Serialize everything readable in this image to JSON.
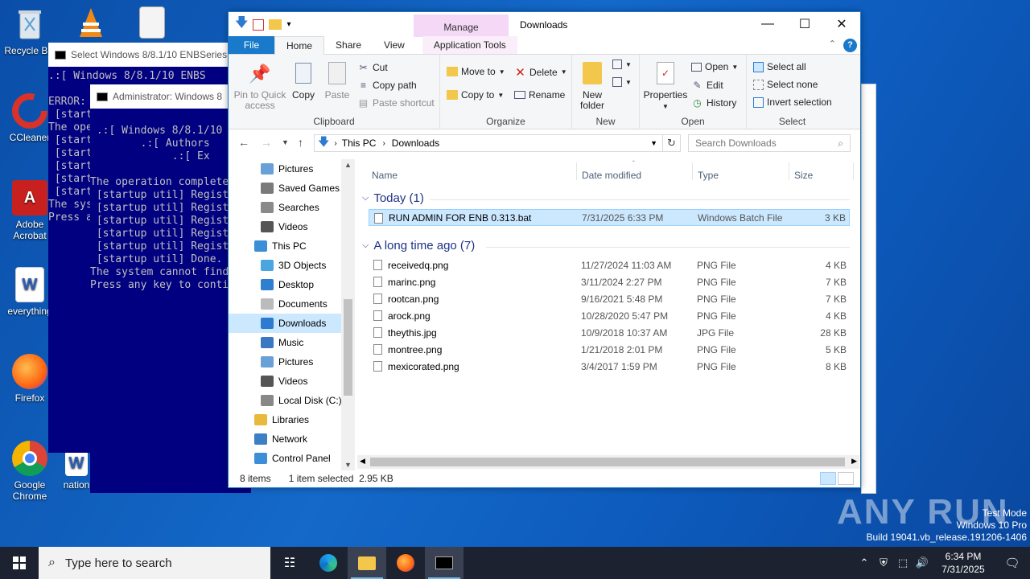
{
  "desktop": {
    "icons": [
      {
        "label": "Recycle Bin"
      },
      {
        "label": "CCleaner"
      },
      {
        "label": "Adobe Acrobat"
      },
      {
        "label": "everything"
      },
      {
        "label": "Firefox"
      },
      {
        "label": "Google Chrome"
      },
      {
        "label": "nation"
      }
    ]
  },
  "console_back": {
    "title": "Select Windows 8/8.1/10 ENBSeries 0",
    "lines": [
      ".:[ Windows 8/8.1/10 ENBS",
      "",
      "ERROR:",
      " [start",
      "The ope",
      " [start",
      " [start",
      " [start",
      " [start",
      " [start",
      "The sys",
      "Press a"
    ]
  },
  "console_front": {
    "title": "Administrator:  Windows 8",
    "lines": [
      "",
      " .:[ Windows 8/8.1/10",
      "        .:[ Authors",
      "             .:[ Ex",
      "",
      "The operation complete",
      " [startup util] Regist",
      " [startup util] Regist",
      " [startup util] Regist",
      " [startup util] Regist",
      " [startup util] Regist",
      " [startup util] Done.",
      "The system cannot find",
      "Press any key to conti"
    ]
  },
  "explorer": {
    "title": "Downloads",
    "manage_tab": "Manage",
    "tabs": {
      "file": "File",
      "home": "Home",
      "share": "Share",
      "view": "View",
      "app_tools": "Application Tools"
    },
    "ribbon": {
      "clipboard": {
        "label": "Clipboard",
        "pin": "Pin to Quick access",
        "copy": "Copy",
        "paste": "Paste",
        "cut": "Cut",
        "copy_path": "Copy path",
        "paste_shortcut": "Paste shortcut"
      },
      "organize": {
        "label": "Organize",
        "move_to": "Move to",
        "copy_to": "Copy to",
        "delete": "Delete",
        "rename": "Rename"
      },
      "new": {
        "label": "New",
        "new_folder": "New folder"
      },
      "open": {
        "label": "Open",
        "properties": "Properties",
        "open": "Open",
        "edit": "Edit",
        "history": "History"
      },
      "select": {
        "label": "Select",
        "select_all": "Select all",
        "select_none": "Select none",
        "invert": "Invert selection"
      }
    },
    "address": {
      "parts": [
        "This PC",
        "Downloads"
      ],
      "search_placeholder": "Search Downloads"
    },
    "nav": [
      {
        "label": "Pictures",
        "indent": 1,
        "color": "#6aa0d8"
      },
      {
        "label": "Saved Games",
        "indent": 1,
        "color": "#7a7a7a"
      },
      {
        "label": "Searches",
        "indent": 1,
        "color": "#8a8a8a"
      },
      {
        "label": "Videos",
        "indent": 1,
        "color": "#555"
      },
      {
        "label": "This PC",
        "indent": 0,
        "color": "#3c8fd6"
      },
      {
        "label": "3D Objects",
        "indent": 1,
        "color": "#4aa6e0"
      },
      {
        "label": "Desktop",
        "indent": 1,
        "color": "#2f7fd0"
      },
      {
        "label": "Documents",
        "indent": 1,
        "color": "#bbb"
      },
      {
        "label": "Downloads",
        "indent": 1,
        "color": "#2d7bd0",
        "selected": true
      },
      {
        "label": "Music",
        "indent": 1,
        "color": "#3a78c4"
      },
      {
        "label": "Pictures",
        "indent": 1,
        "color": "#6aa0d8"
      },
      {
        "label": "Videos",
        "indent": 1,
        "color": "#555"
      },
      {
        "label": "Local Disk (C:)",
        "indent": 1,
        "color": "#888"
      },
      {
        "label": "Libraries",
        "indent": 0,
        "color": "#e8b93c"
      },
      {
        "label": "Network",
        "indent": 0,
        "color": "#3c7fc4"
      },
      {
        "label": "Control Panel",
        "indent": 0,
        "color": "#3c8fd6"
      }
    ],
    "columns": {
      "name": "Name",
      "date": "Date modified",
      "type": "Type",
      "size": "Size"
    },
    "groups": [
      {
        "title": "Today (1)",
        "files": [
          {
            "name": "RUN ADMIN FOR ENB 0.313.bat",
            "date": "7/31/2025 6:33 PM",
            "type": "Windows Batch File",
            "size": "3 KB",
            "selected": true
          }
        ]
      },
      {
        "title": "A long time ago (7)",
        "files": [
          {
            "name": "receivedq.png",
            "date": "11/27/2024 11:03 AM",
            "type": "PNG File",
            "size": "4 KB"
          },
          {
            "name": "marinc.png",
            "date": "3/11/2024 2:27 PM",
            "type": "PNG File",
            "size": "7 KB"
          },
          {
            "name": "rootcan.png",
            "date": "9/16/2021 5:48 PM",
            "type": "PNG File",
            "size": "7 KB"
          },
          {
            "name": "arock.png",
            "date": "10/28/2020 5:47 PM",
            "type": "PNG File",
            "size": "4 KB"
          },
          {
            "name": "theythis.jpg",
            "date": "10/9/2018 10:37 AM",
            "type": "JPG File",
            "size": "28 KB"
          },
          {
            "name": "montree.png",
            "date": "1/21/2018 2:01 PM",
            "type": "PNG File",
            "size": "5 KB"
          },
          {
            "name": "mexicorated.png",
            "date": "3/4/2017 1:59 PM",
            "type": "PNG File",
            "size": "8 KB"
          }
        ]
      }
    ],
    "status": {
      "items": "8 items",
      "selected": "1 item selected  2.95 KB"
    }
  },
  "watermark": {
    "text": "ANY RUN",
    "mode": "Test Mode",
    "os": "Windows 10 Pro",
    "build": "Build 19041.vb_release.191206-1406"
  },
  "taskbar": {
    "search_placeholder": "Type here to search",
    "time": "6:34 PM",
    "date": "7/31/2025"
  }
}
